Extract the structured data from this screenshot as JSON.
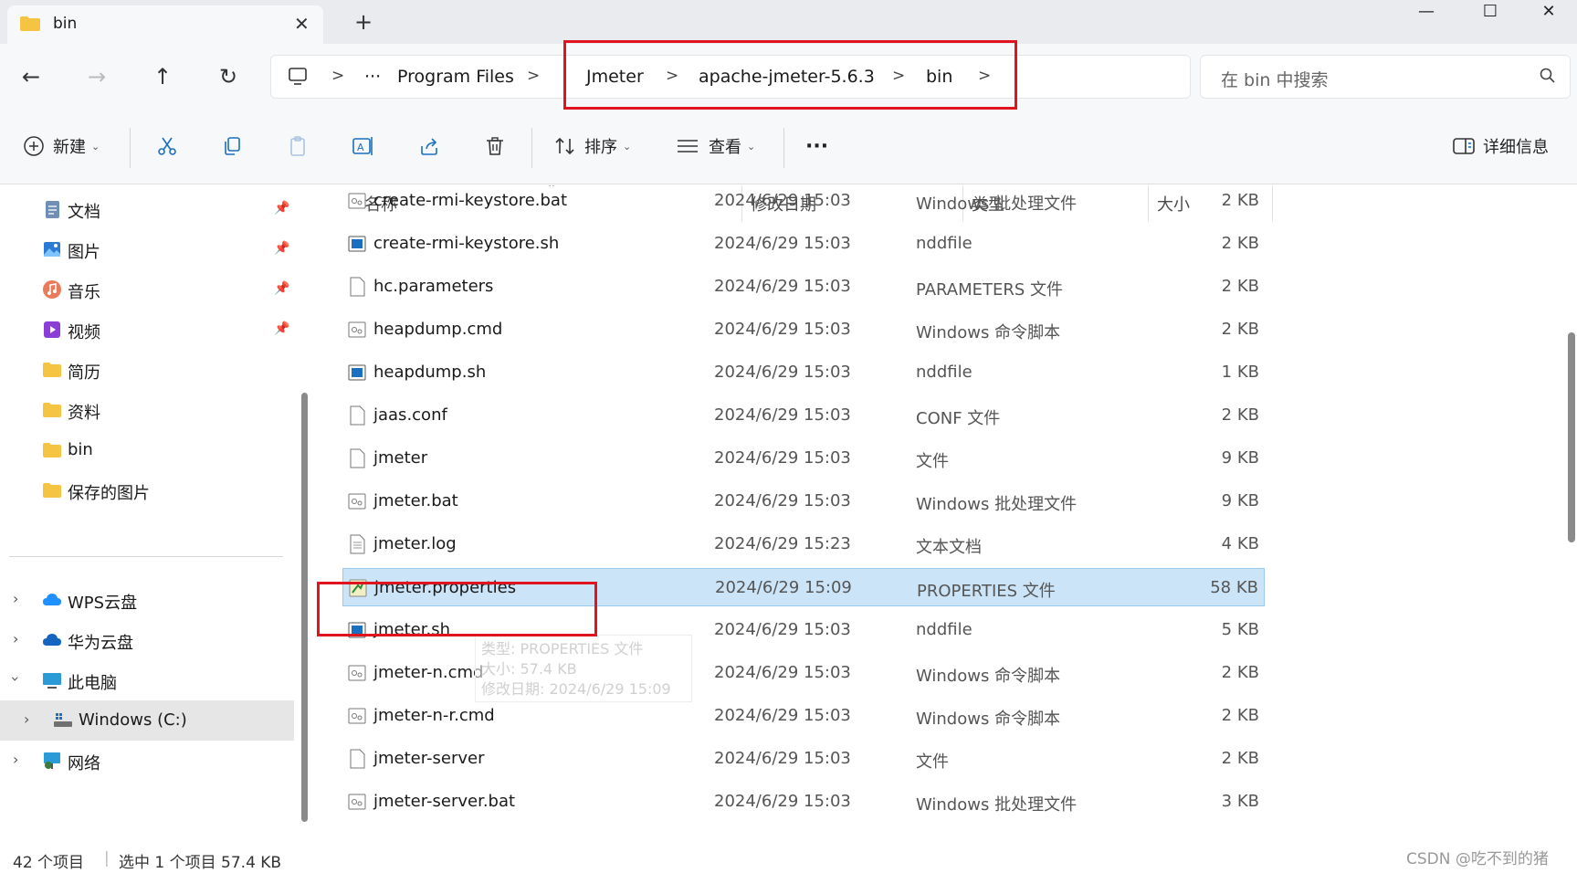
{
  "tab": {
    "title": "bin"
  },
  "window_controls": {
    "minimize": "—",
    "maximize": "☐",
    "close": "✕"
  },
  "address": {
    "crumbs": [
      "Program Files",
      "Jmeter",
      "apache-jmeter-5.6.3",
      "bin"
    ],
    "overflow": "···"
  },
  "search": {
    "placeholder": "在 bin 中搜索"
  },
  "toolbar": {
    "new_label": "新建",
    "sort_label": "排序",
    "view_label": "查看",
    "more_label": "···",
    "details_label": "详细信息"
  },
  "sidebar": {
    "quick": [
      {
        "label": "文档",
        "icon": "document-icon",
        "pinned": true
      },
      {
        "label": "图片",
        "icon": "pictures-icon",
        "pinned": true
      },
      {
        "label": "音乐",
        "icon": "music-icon",
        "pinned": true
      },
      {
        "label": "视频",
        "icon": "video-icon",
        "pinned": true
      },
      {
        "label": "简历",
        "icon": "folder-icon",
        "pinned": false
      },
      {
        "label": "资料",
        "icon": "folder-icon",
        "pinned": false
      },
      {
        "label": "bin",
        "icon": "folder-icon",
        "pinned": false
      },
      {
        "label": "保存的图片",
        "icon": "folder-icon",
        "pinned": false
      }
    ],
    "tree": [
      {
        "label": "WPS云盘",
        "icon": "cloud-icon"
      },
      {
        "label": "华为云盘",
        "icon": "cloud-icon"
      },
      {
        "label": "此电脑",
        "icon": "computer-icon"
      },
      {
        "label": "Windows (C:)",
        "icon": "drive-icon"
      },
      {
        "label": "网络",
        "icon": "network-icon"
      }
    ]
  },
  "columns": {
    "name": "名称",
    "date": "修改日期",
    "type": "类型",
    "size": "大小"
  },
  "files": [
    {
      "name": "create-rmi-keystore.bat",
      "date": "2024/6/29 15:03",
      "type": "Windows 批处理文件",
      "size": "2 KB",
      "icon": "batch-file-icon"
    },
    {
      "name": "create-rmi-keystore.sh",
      "date": "2024/6/29 15:03",
      "type": "nddfile",
      "size": "2 KB",
      "icon": "shell-file-icon"
    },
    {
      "name": "hc.parameters",
      "date": "2024/6/29 15:03",
      "type": "PARAMETERS 文件",
      "size": "2 KB",
      "icon": "blank-file-icon"
    },
    {
      "name": "heapdump.cmd",
      "date": "2024/6/29 15:03",
      "type": "Windows 命令脚本",
      "size": "2 KB",
      "icon": "batch-file-icon"
    },
    {
      "name": "heapdump.sh",
      "date": "2024/6/29 15:03",
      "type": "nddfile",
      "size": "1 KB",
      "icon": "shell-file-icon"
    },
    {
      "name": "jaas.conf",
      "date": "2024/6/29 15:03",
      "type": "CONF 文件",
      "size": "2 KB",
      "icon": "blank-file-icon"
    },
    {
      "name": "jmeter",
      "date": "2024/6/29 15:03",
      "type": "文件",
      "size": "9 KB",
      "icon": "blank-file-icon"
    },
    {
      "name": "jmeter.bat",
      "date": "2024/6/29 15:03",
      "type": "Windows 批处理文件",
      "size": "9 KB",
      "icon": "batch-file-icon"
    },
    {
      "name": "jmeter.log",
      "date": "2024/6/29 15:23",
      "type": "文本文档",
      "size": "4 KB",
      "icon": "text-file-icon"
    },
    {
      "name": "jmeter.properties",
      "date": "2024/6/29 15:09",
      "type": "PROPERTIES 文件",
      "size": "58 KB",
      "icon": "properties-file-icon",
      "selected": true
    },
    {
      "name": "jmeter.sh",
      "date": "2024/6/29 15:03",
      "type": "nddfile",
      "size": "5 KB",
      "icon": "shell-file-icon"
    },
    {
      "name": "jmeter-n.cmd",
      "date": "2024/6/29 15:03",
      "type": "Windows 命令脚本",
      "size": "2 KB",
      "icon": "batch-file-icon"
    },
    {
      "name": "jmeter-n-r.cmd",
      "date": "2024/6/29 15:03",
      "type": "Windows 命令脚本",
      "size": "2 KB",
      "icon": "batch-file-icon"
    },
    {
      "name": "jmeter-server",
      "date": "2024/6/29 15:03",
      "type": "文件",
      "size": "2 KB",
      "icon": "blank-file-icon"
    },
    {
      "name": "jmeter-server.bat",
      "date": "2024/6/29 15:03",
      "type": "Windows 批处理文件",
      "size": "3 KB",
      "icon": "batch-file-icon"
    }
  ],
  "tooltip": {
    "type": "类型: PROPERTIES 文件",
    "size": "大小: 57.4 KB",
    "modified": "修改日期: 2024/6/29 15:09"
  },
  "status": {
    "count": "42 个项目",
    "selection": "选中 1 个项目 57.4 KB"
  },
  "watermark": "CSDN @吃不到的猪",
  "colors": {
    "selection": "#cce4f7",
    "highlight_box": "#e0141e",
    "folder": "#f5c442"
  }
}
